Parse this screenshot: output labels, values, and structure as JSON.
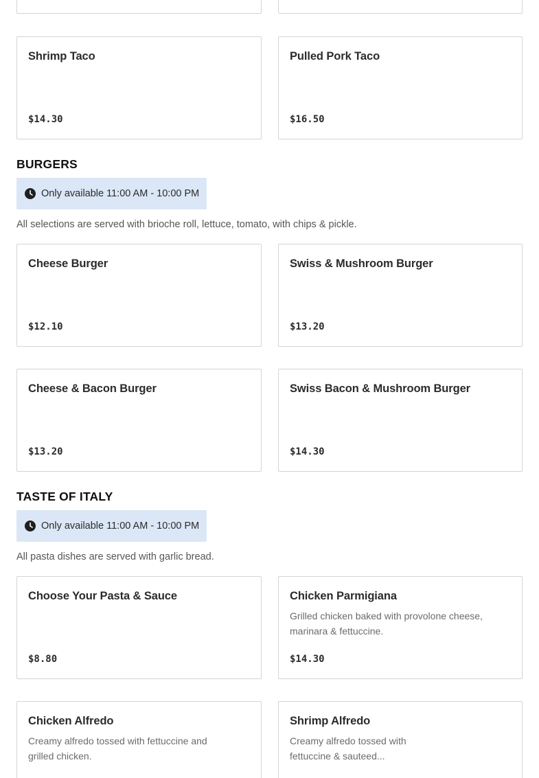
{
  "tacos": {
    "items": [
      {
        "name": "Shrimp Taco",
        "price": "$14.30"
      },
      {
        "name": "Pulled Pork Taco",
        "price": "$16.50"
      }
    ]
  },
  "burgers": {
    "title": "BURGERS",
    "availability": "Only available 11:00 AM - 10:00 PM",
    "note": "All selections are served with brioche roll, lettuce, tomato, with chips & pickle.",
    "items": [
      {
        "name": "Cheese Burger",
        "price": "$12.10"
      },
      {
        "name": "Swiss & Mushroom Burger",
        "price": "$13.20"
      },
      {
        "name": "Cheese & Bacon Burger",
        "price": "$13.20"
      },
      {
        "name": "Swiss Bacon & Mushroom Burger",
        "price": "$14.30"
      }
    ]
  },
  "italy": {
    "title": "TASTE OF ITALY",
    "availability": "Only available 11:00 AM - 10:00 PM",
    "note": "All pasta dishes are served with garlic bread.",
    "items": [
      {
        "name": "Choose Your Pasta & Sauce",
        "price": "$8.80"
      },
      {
        "name": "Chicken Parmigiana",
        "description": "Grilled chicken baked with provolone cheese, marinara & fettuccine.",
        "price": "$14.30"
      },
      {
        "name": "Chicken Alfredo",
        "description": "Creamy alfredo tossed with fettuccine and grilled chicken."
      },
      {
        "name": "Shrimp Alfredo",
        "description": "Creamy alfredo tossed with fettuccine & sauteed..."
      }
    ]
  },
  "icons": {
    "clock": "clock-icon"
  }
}
